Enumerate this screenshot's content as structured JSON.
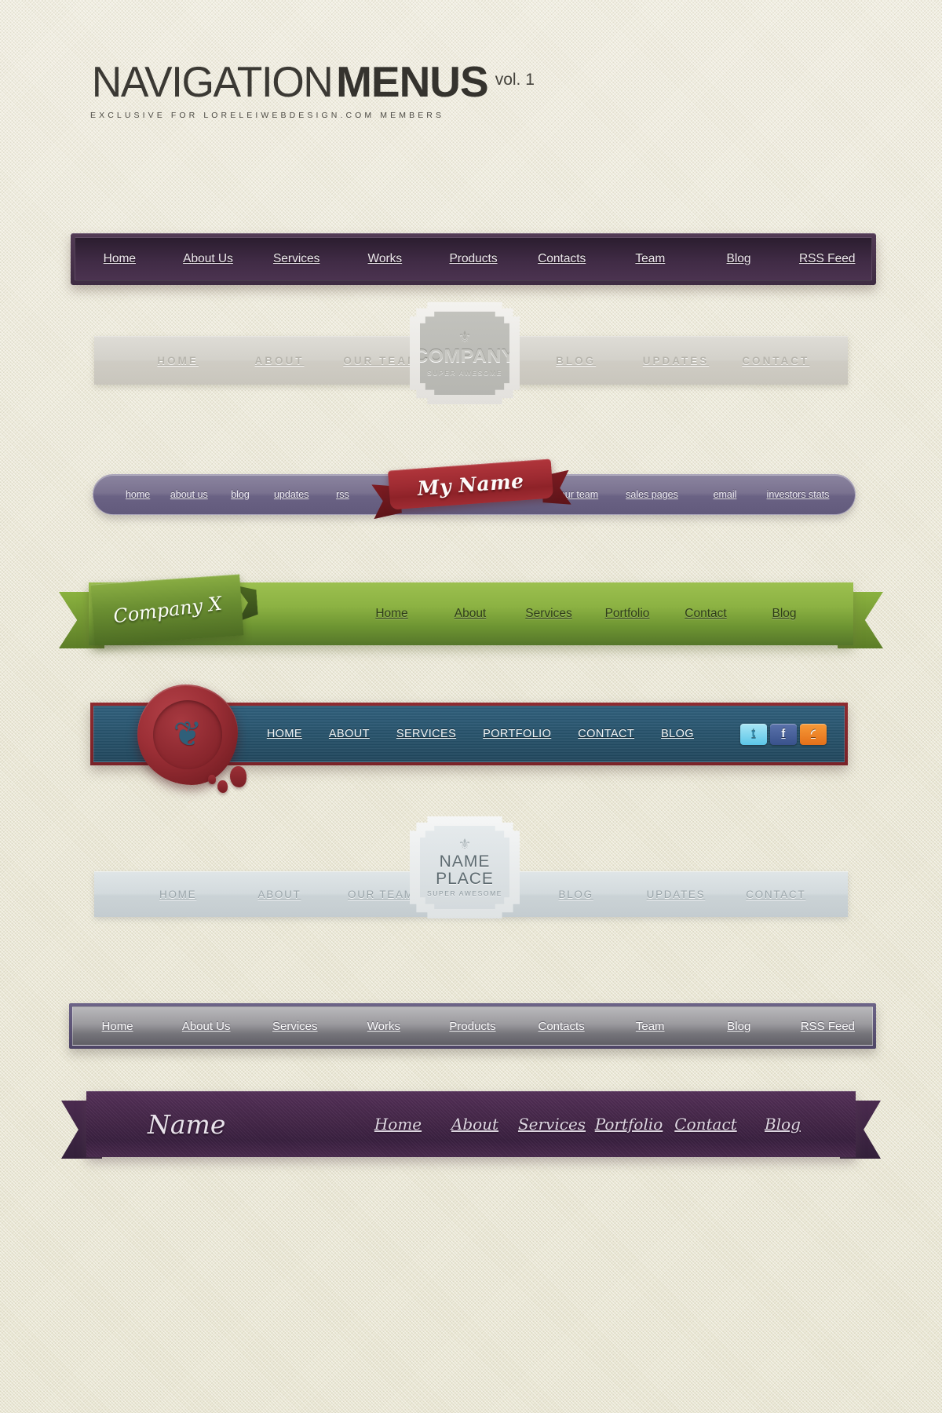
{
  "header": {
    "title_thin": "NAVIGATION",
    "title_bold": "MENUS",
    "volume": "vol. 1",
    "subtitle": "EXCLUSIVE FOR LORELEIWEBDESIGN.COM MEMBERS"
  },
  "nav1": {
    "name": "dark-plum-bar",
    "items": [
      "Home",
      "About Us",
      "Services",
      "Works",
      "Products",
      "Contacts",
      "Team",
      "Blog",
      "RSS Feed"
    ]
  },
  "nav2": {
    "name": "gray-badge-bar",
    "left_items": [
      "HOME",
      "ABOUT",
      "OUR TEAM"
    ],
    "right_items": [
      "BLOG",
      "UPDATES",
      "CONTACT"
    ],
    "badge": {
      "fleur": "⚜",
      "name": "COMPANY",
      "sub": "SUPER AWESOME"
    }
  },
  "nav3": {
    "name": "lavender-pill-bar",
    "left_items": [
      "home",
      "about us",
      "blog",
      "updates",
      "rss"
    ],
    "right_items": [
      "our team",
      "sales pages",
      "email",
      "investors stats"
    ],
    "ribbon_label": "My Name"
  },
  "nav4": {
    "name": "green-ribbon-bar",
    "ribbon_label": "Company X",
    "items": [
      "Home",
      "About",
      "Services",
      "Portfolio",
      "Contact",
      "Blog"
    ]
  },
  "nav5": {
    "name": "teal-wax-seal-bar",
    "items": [
      "HOME",
      "ABOUT",
      "SERVICES",
      "PORTFOLIO",
      "CONTACT",
      "BLOG"
    ],
    "seal_mark": "❦",
    "social": [
      {
        "id": "twitter-icon",
        "glyph": "t"
      },
      {
        "id": "facebook-icon",
        "glyph": "f"
      },
      {
        "id": "rss-icon",
        "glyph": "◜"
      }
    ]
  },
  "nav6": {
    "name": "pale-blue-badge-bar",
    "left_items": [
      "HOME",
      "ABOUT",
      "OUR TEAM"
    ],
    "right_items": [
      "BLOG",
      "UPDATES",
      "CONTACT"
    ],
    "badge": {
      "fleur": "⚜",
      "line1": "NAME",
      "line2": "PLACE",
      "sub": "SUPER AWESOME"
    }
  },
  "nav7": {
    "name": "silver-framed-bar",
    "items": [
      "Home",
      "About Us",
      "Services",
      "Works",
      "Products",
      "Contacts",
      "Team",
      "Blog",
      "RSS Feed"
    ]
  },
  "nav8": {
    "name": "plum-script-ribbon-bar",
    "brand": "Name",
    "items": [
      "Home",
      "About",
      "Services",
      "Portfolio",
      "Contact",
      "Blog"
    ]
  },
  "colors": {
    "page_bg": "#ece9d8",
    "plum": "#3e2b42",
    "lavender": "#7a7290",
    "green": "#8cb243",
    "teal": "#27536c",
    "seal_red": "#9c2f36",
    "ribbon_red": "#9d2a31",
    "silver": "#9b9a9e",
    "script_plum": "#452749"
  }
}
